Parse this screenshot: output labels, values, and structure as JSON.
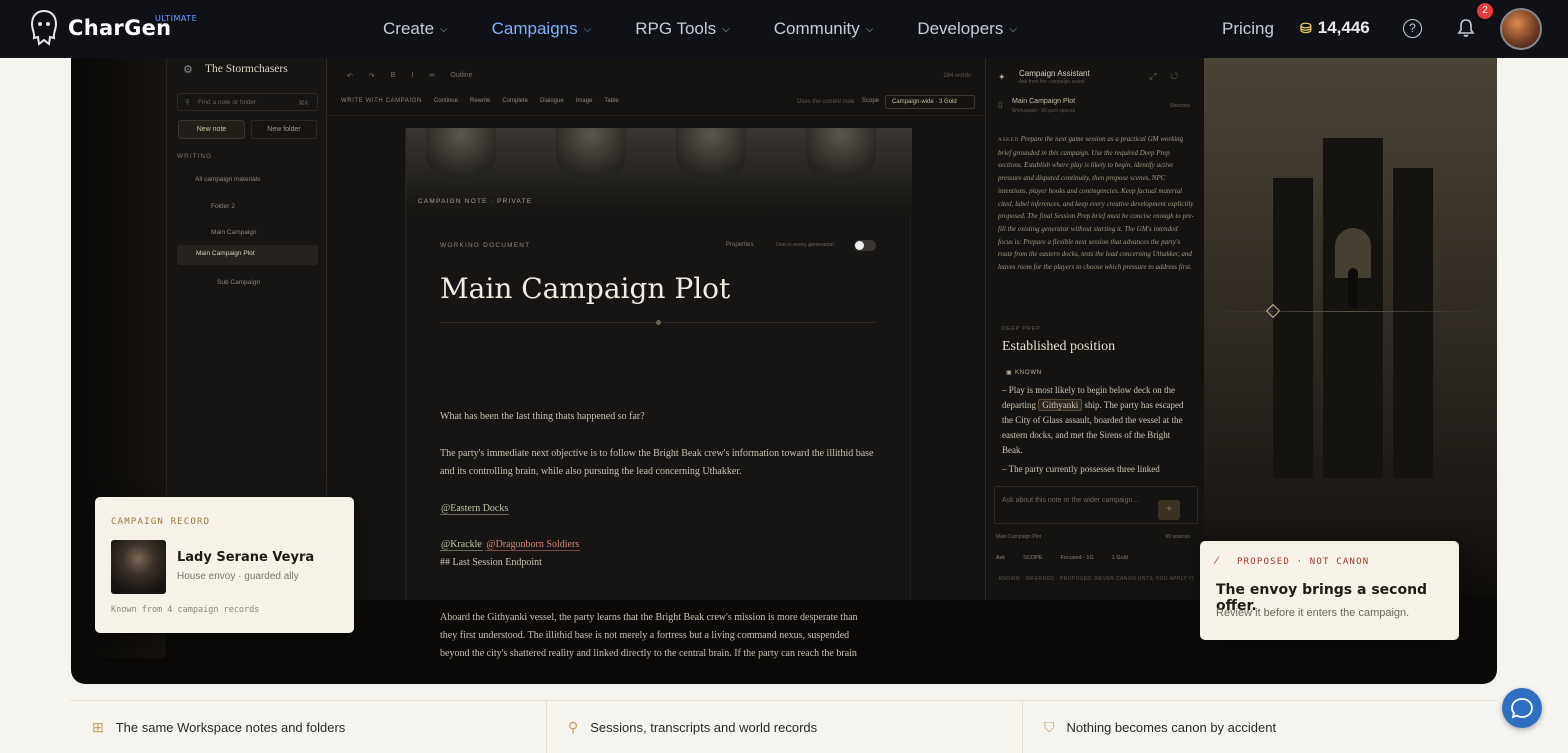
{
  "nav": {
    "brand": "CharGen",
    "tier": "ULTIMATE",
    "menu": [
      {
        "label": "Create",
        "active": false
      },
      {
        "label": "Campaigns",
        "active": true
      },
      {
        "label": "RPG Tools",
        "active": false
      },
      {
        "label": "Community",
        "active": false
      },
      {
        "label": "Developers",
        "active": false
      }
    ],
    "pricing": "Pricing",
    "credits": "14,446",
    "notifications": "2"
  },
  "workspace": {
    "name": "The Stormchasers",
    "search_placeholder": "Find a note or folder",
    "search_shortcut": "⌘K",
    "new_note": "New note",
    "new_folder": "New folder",
    "section": "WRITING",
    "tree": [
      "All campaign materials",
      "Folder 2",
      "Main Campaign",
      "Main Campaign Plot",
      "Sub Campaign"
    ]
  },
  "toolbar": {
    "outline": "Outline",
    "word_count": "284 words",
    "write_with": "WRITE WITH CAMPAIGN",
    "actions": [
      "Continue",
      "Rewrite",
      "Complete",
      "Dialogue",
      "Image",
      "Table"
    ],
    "hint": "Uses the current note",
    "scope_label": "Scope",
    "scope_value": "Campaign-wide · 3 Gold"
  },
  "document": {
    "note_label": "CAMPAIGN NOTE · PRIVATE",
    "doc_label": "WORKING DOCUMENT",
    "properties": "Properties",
    "use_in_generation": "Use in every generation",
    "title": "Main Campaign Plot",
    "para1": "What has been the last thing thats happened so far?",
    "para2": "The party's immediate next objective is to follow the Bright Beak crew's information toward the illithid base and its controlling brain, while also pursuing the lead concerning Uthakker.",
    "tag_docks": "@Eastern Docks",
    "tag_krackle": "@Krackle",
    "tag_soldiers": "@Dragonborn Soldiers",
    "heading_line": "## Last Session Endpoint",
    "para3": "Aboard the Githyanki vessel, the party learns that the Bright Beak crew's mission is more desperate than they first understood. The illithid base is not merely a fortress but a living command nexus, suspended beyond the city's shattered reality and linked directly to the central brain. If the party can reach the brain"
  },
  "assistant": {
    "title": "Campaign Assistant",
    "subtitle": "Ask from the campaign assist",
    "note": "Main Campaign Plot",
    "note_sub": "Workspace · 60 pool spaces",
    "sources": "Sources",
    "asked_label": "ASKED",
    "asked_text": "Prepare the next game session as a practical GM working brief grounded in this campaign. Use the required Deep Prep sections. Establish where play is likely to begin, identify active pressure and disputed continuity, then propose scenes, NPC intentions, player hooks and contingencies. Keep factual material cited, label inferences, and keep every creative development explicitly proposed. The final Session Prep brief must be concise enough to pre-fill the existing generator without starting it. The GM's intended focus is: Prepare a flexible next session that advances the party's route from the eastern docks, tests the lead concerning Uthakker, and leaves room for the players to choose which pressure to address first.",
    "deep_prep": "DEEP PREP",
    "section_title": "Established position",
    "known": "KNOWN",
    "bullet1_a": "– Play is most likely to begin below deck on the departing",
    "bullet1_gith": "Githyanki",
    "bullet1_b": "ship. The party has escaped the City of Glass assault, boarded the vessel at the eastern docks, and met the Sirens of the Bright Beak.",
    "bullet2": "– The party currently possesses three linked",
    "ask_placeholder": "Ask about this note or the wider campaign...",
    "footer_note": "Main Campaign Plot",
    "footer_sources": "60 sources",
    "mode": "Ask",
    "scope": "SCOPE",
    "focus": "Focused · 1G",
    "cost": "1 Gold",
    "disclaimer": "KNOWN · INFERRED · PROPOSED. NEVER CANON UNTIL YOU APPLY IT."
  },
  "record_card": {
    "label": "CAMPAIGN RECORD",
    "name": "Lady Serane Veyra",
    "role": "House envoy · guarded ally",
    "known_from": "Known from 4 campaign records"
  },
  "proposal_card": {
    "label": "PROPOSED · NOT CANON",
    "title": "The envoy brings a second offer.",
    "subtitle": "Review it before it enters the campaign."
  },
  "features": [
    {
      "icon": "folders-icon",
      "label": "The same Workspace notes and folders"
    },
    {
      "icon": "search-icon",
      "label": "Sessions, transcripts and world records"
    },
    {
      "icon": "shield-icon",
      "label": "Nothing becomes canon by accident"
    }
  ]
}
